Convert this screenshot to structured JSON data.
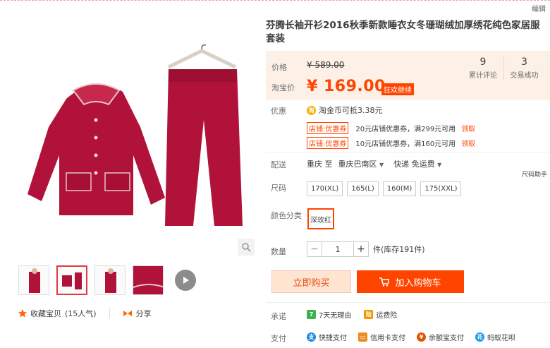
{
  "edit_link": "编辑",
  "title": "芬腾长袖开衫2016秋季新款睡衣女冬珊瑚绒加厚绣花纯色家居服套装",
  "price": {
    "label": "价格",
    "original": "¥ 589.00",
    "promo_label": "淘宝价",
    "promo": "¥ 169.00",
    "promo_badge": "狂欢继续"
  },
  "stats": [
    {
      "num": "9",
      "label": "累计评论"
    },
    {
      "num": "3",
      "label": "交易成功"
    }
  ],
  "promotions": {
    "label": "优惠",
    "coin_text": "淘金币可抵3.38元",
    "coupons": [
      {
        "tag": "店铺:优惠券",
        "text": "20元店铺优惠券，满299元可用",
        "claim": "领取"
      },
      {
        "tag": "店铺:优惠券",
        "text": "10元店铺优惠券，满160元可用",
        "claim": "领取"
      }
    ]
  },
  "shipping": {
    "label": "配送",
    "from": "重庆 至",
    "to": "重庆巴南区",
    "method": "快递 免运费"
  },
  "size_helper": "尺码助手",
  "size": {
    "label": "尺码",
    "options": [
      "170(XL)",
      "165(L)",
      "160(M)",
      "175(XXL)"
    ]
  },
  "color": {
    "label": "颜色分类",
    "selected": "深玫红"
  },
  "quantity": {
    "label": "数量",
    "value": "1",
    "stock": "件(库存191件)"
  },
  "buttons": {
    "buy_now": "立即购买",
    "add_cart": "加入购物车"
  },
  "gallery_actions": {
    "favorite": "收藏宝贝",
    "favorite_count": "(15人气)",
    "share": "分享"
  },
  "promise": {
    "label": "承诺",
    "items": [
      "7天无理由",
      "运费险"
    ]
  },
  "payment": {
    "label": "支付",
    "items": [
      "快捷支付",
      "信用卡支付",
      "余额宝支付",
      "蚂蚁花呗"
    ]
  },
  "colors": {
    "accent": "#ff4400",
    "product": "#b0123a",
    "price_bg": "#fcf0e7"
  }
}
